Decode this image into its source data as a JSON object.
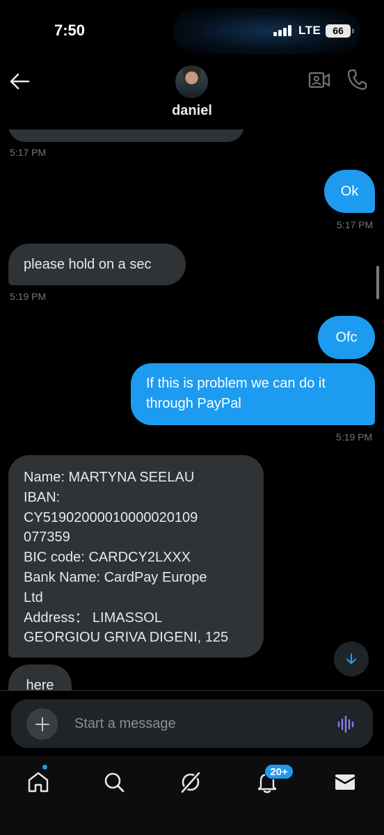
{
  "status_bar": {
    "time": "7:50",
    "network": "LTE",
    "battery": "66"
  },
  "header": {
    "contact_name": "daniel"
  },
  "messages": [
    {
      "direction": "in",
      "text": "",
      "time": "5:17 PM"
    },
    {
      "direction": "out",
      "text": "Ok",
      "time": "5:17 PM"
    },
    {
      "direction": "in",
      "text": "please hold on a sec",
      "time": "5:19 PM"
    },
    {
      "direction": "out",
      "text": "Ofc",
      "time": ""
    },
    {
      "direction": "out",
      "text": "If this is problem we can do it through PayPal",
      "time": "5:19 PM"
    },
    {
      "direction": "in",
      "text": "",
      "lines": [
        "Name: MARTYNA SEELAU",
        "IBAN:",
        "CY5190200001000002010​9",
        "077359",
        "BIC code: CARDCY2LXXX",
        "Bank Name: CardPay Europe",
        "Ltd",
        "Address： LIMASSOL",
        "GEORGIOU GRIVA DIGENI, 125"
      ],
      "time": ""
    },
    {
      "direction": "in",
      "text": "here",
      "time": ""
    }
  ],
  "composer": {
    "placeholder": "Start a message"
  },
  "nav": {
    "notifications_badge": "20+"
  },
  "colors": {
    "background": "#000000",
    "incoming_bubble": "#2f3336",
    "outgoing_bubble": "#1d9bf0",
    "accent": "#1d9bf0",
    "voice_icon": "#8b7cf6"
  },
  "icons": {
    "back": "arrow-left-icon",
    "video": "video-camera-icon",
    "call": "phone-icon",
    "jump": "arrow-down-icon",
    "add": "plus-icon",
    "voice": "waveform-icon",
    "home": "home-icon",
    "search": "search-icon",
    "grok": "grok-slash-icon",
    "notifications": "bell-icon",
    "messages": "envelope-icon"
  }
}
